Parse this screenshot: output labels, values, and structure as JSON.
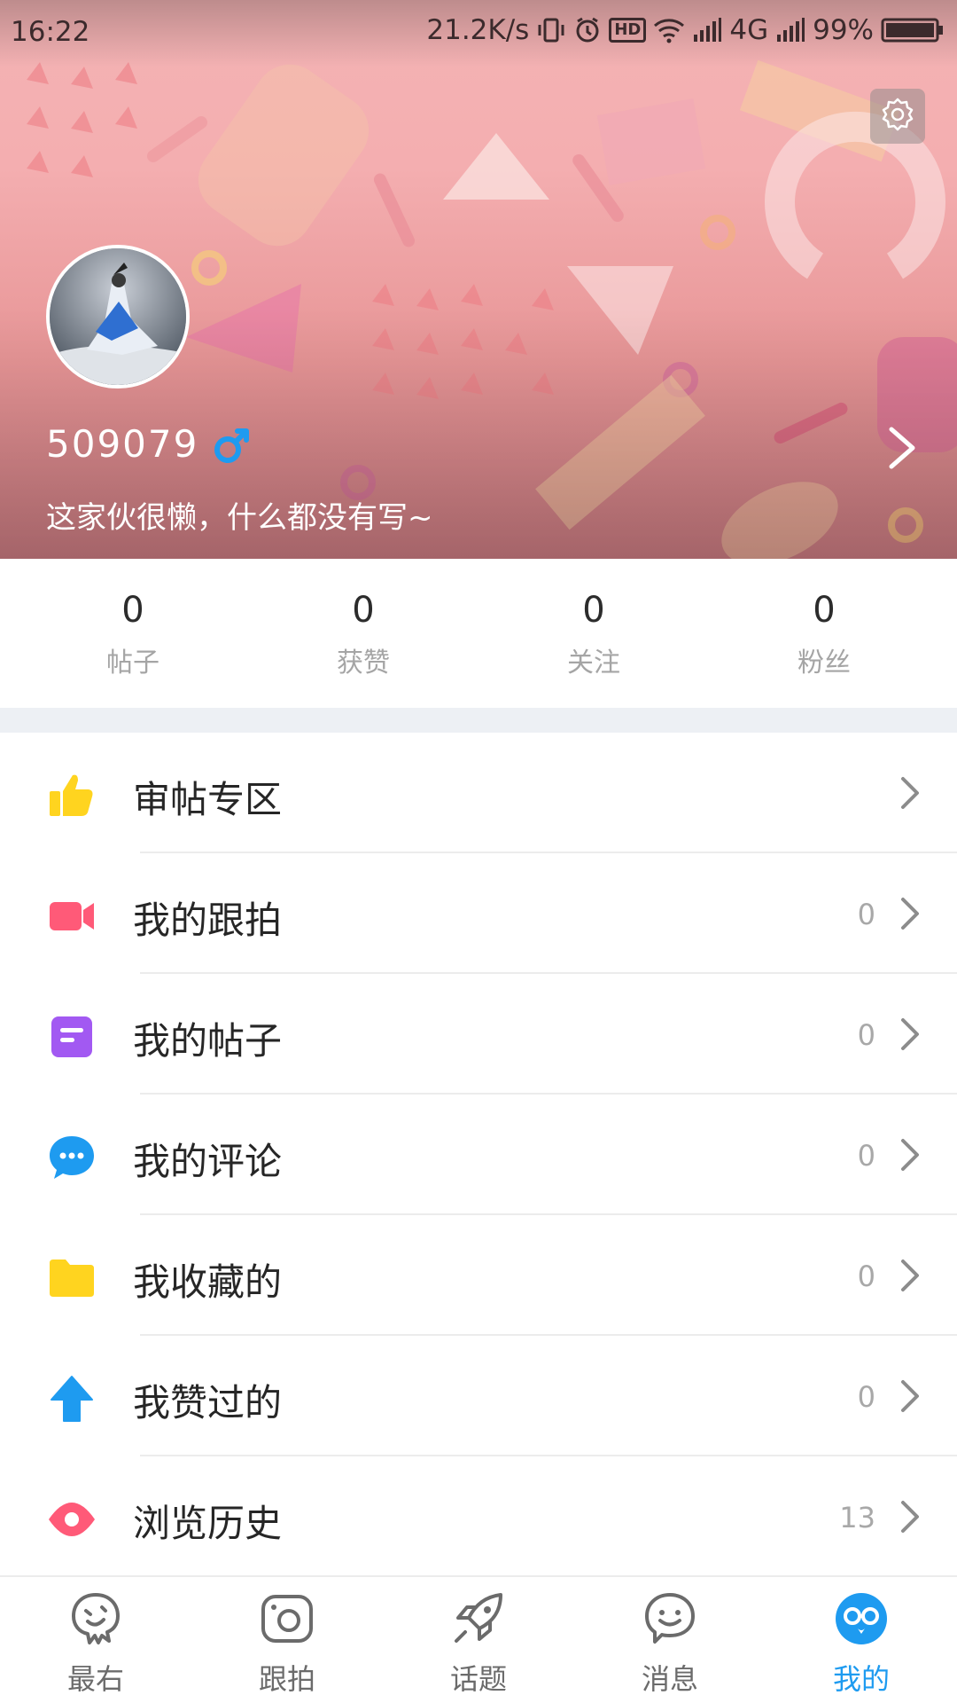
{
  "status_bar": {
    "time": "16:22",
    "net_speed": "21.2K/s",
    "hd_label": "HD",
    "network": "4G",
    "battery": "99%"
  },
  "profile": {
    "username": "509079",
    "bio": "这家伙很懒，什么都没有写~",
    "gender_icon": "male-symbol-icon"
  },
  "stats": [
    {
      "value": "0",
      "label": "帖子"
    },
    {
      "value": "0",
      "label": "获赞"
    },
    {
      "value": "0",
      "label": "关注"
    },
    {
      "value": "0",
      "label": "粉丝"
    }
  ],
  "menu": [
    {
      "label": "审帖专区",
      "count": "",
      "icon": "thumbs-up-icon",
      "color": "#ffd41f"
    },
    {
      "label": "我的跟拍",
      "count": "0",
      "icon": "video-camera-icon",
      "color": "#ff5a78"
    },
    {
      "label": "我的帖子",
      "count": "0",
      "icon": "post-icon",
      "color": "#a259f2"
    },
    {
      "label": "我的评论",
      "count": "0",
      "icon": "comment-icon",
      "color": "#1e9bf0"
    },
    {
      "label": "我收藏的",
      "count": "0",
      "icon": "folder-icon",
      "color": "#ffd41f"
    },
    {
      "label": "我赞过的",
      "count": "0",
      "icon": "up-arrow-icon",
      "color": "#1e9bf0"
    },
    {
      "label": "浏览历史",
      "count": "13",
      "icon": "eye-icon",
      "color": "#ff5a78"
    }
  ],
  "tabs": [
    {
      "label": "最右",
      "icon": "mascot-icon",
      "active": false
    },
    {
      "label": "跟拍",
      "icon": "camera-icon",
      "active": false
    },
    {
      "label": "话题",
      "icon": "rocket-icon",
      "active": false
    },
    {
      "label": "消息",
      "icon": "chat-smile-icon",
      "active": false
    },
    {
      "label": "我的",
      "icon": "profile-glasses-icon",
      "active": true
    }
  ],
  "colors": {
    "accent": "#1e9bf0",
    "banner": "#f3b3b4",
    "divider": "#edf0f4"
  }
}
